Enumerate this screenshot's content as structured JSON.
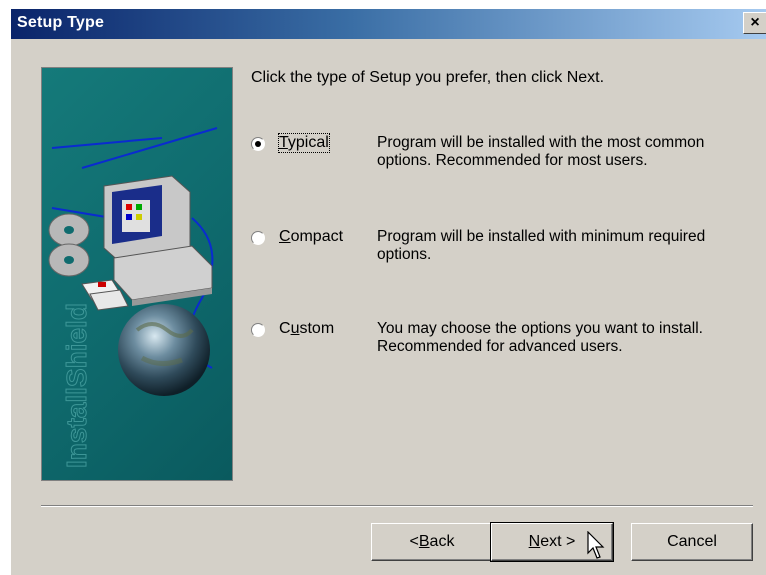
{
  "window": {
    "title": "Setup Type",
    "close_label": "×"
  },
  "banner": {
    "vertical_text": "InstallShield"
  },
  "prompt": "Click the type of Setup you prefer, then click Next.",
  "options": [
    {
      "label_prefix": "",
      "label_accel": "T",
      "label_rest": "ypical",
      "description": "Program will be installed with the most common options.  Recommended for most users.",
      "selected": true
    },
    {
      "label_prefix": "",
      "label_accel": "C",
      "label_rest": "ompact",
      "description": "Program will be installed with minimum required options.",
      "selected": false
    },
    {
      "label_prefix": "C",
      "label_accel": "u",
      "label_rest": "stom",
      "description": "You may choose the options you want to install. Recommended for advanced users.",
      "selected": false
    }
  ],
  "buttons": {
    "back": {
      "prefix": "< ",
      "accel": "B",
      "rest": "ack"
    },
    "next": {
      "prefix": "",
      "accel": "N",
      "rest": "ext >"
    },
    "cancel": "Cancel"
  }
}
